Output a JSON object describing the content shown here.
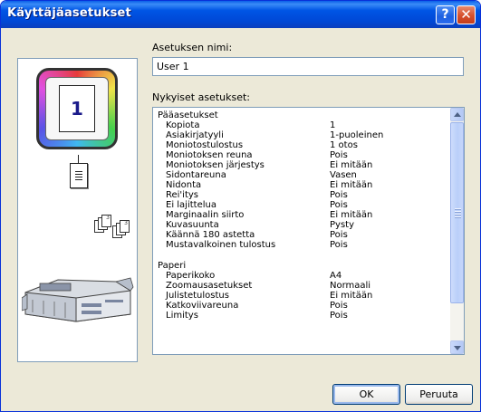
{
  "window": {
    "title": "Käyttäjäasetukset",
    "help_icon": "question-mark-icon",
    "close_icon": "close-x-icon"
  },
  "preview": {
    "copies_number": "1",
    "icons": [
      "color-page-icon",
      "single-document-icon",
      "collate-sheets-icon",
      "printer-machine-icon"
    ]
  },
  "form": {
    "name_label": "Asetuksen nimi:",
    "name_value": "User 1",
    "current_label": "Nykyiset asetukset:"
  },
  "settings": {
    "groups": [
      {
        "title": "Pääasetukset",
        "rows": [
          {
            "key": "Kopiota",
            "value": "1"
          },
          {
            "key": "Asiakirjatyyli",
            "value": "1-puoleinen"
          },
          {
            "key": "Moniotostulostus",
            "value": "1 otos"
          },
          {
            "key": "Moniotoksen reuna",
            "value": "Pois"
          },
          {
            "key": "Moniotoksen järjestys",
            "value": "Ei mitään"
          },
          {
            "key": "Sidontareuna",
            "value": "Vasen"
          },
          {
            "key": "Nidonta",
            "value": "Ei mitään"
          },
          {
            "key": "Rei'itys",
            "value": "Pois"
          },
          {
            "key": "Ei lajittelua",
            "value": "Pois"
          },
          {
            "key": "Marginaalin siirto",
            "value": "Ei mitään"
          },
          {
            "key": "Kuvasuunta",
            "value": "Pysty"
          },
          {
            "key": "Käännä 180 astetta",
            "value": "Pois"
          },
          {
            "key": "Mustavalkoinen tulostus",
            "value": "Pois"
          }
        ]
      },
      {
        "title": "Paperi",
        "rows": [
          {
            "key": "Paperikoko",
            "value": "A4"
          },
          {
            "key": "Zoomausasetukset",
            "value": "Normaali"
          },
          {
            "key": "Julistetulostus",
            "value": "Ei mitään"
          },
          {
            "key": "Katkoviivareuna",
            "value": "Pois"
          },
          {
            "key": "Limitys",
            "value": "Pois"
          }
        ]
      }
    ]
  },
  "buttons": {
    "ok": "OK",
    "cancel": "Peruuta"
  },
  "colors": {
    "titlebar": "#0055e5",
    "dialog_bg": "#ece9d8",
    "field_border": "#7f9db9"
  }
}
